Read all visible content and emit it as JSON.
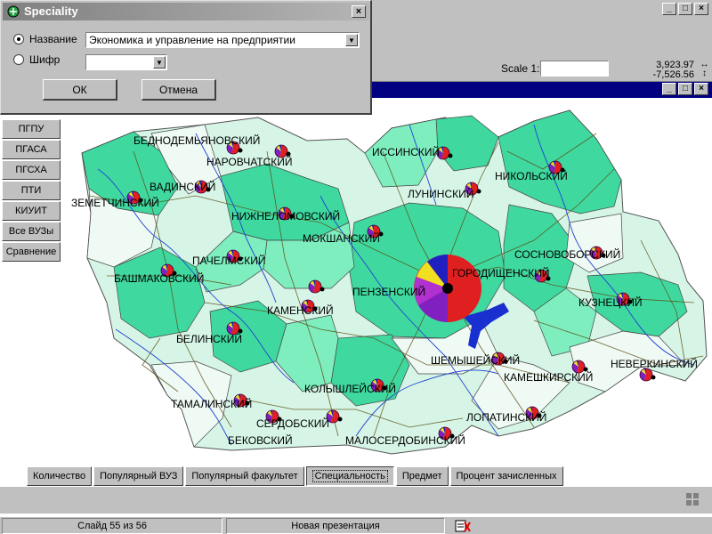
{
  "app": {
    "minimize_label": "_",
    "maximize_label": "□",
    "close_label": "×"
  },
  "view": {
    "scale_label": "Scale 1:",
    "scale_value": "",
    "coord_x": "3,923.97",
    "coord_y": "-7,526.56",
    "coord_arrows": "↔ ↕"
  },
  "dialog": {
    "title": "Speciality",
    "close_label": "×",
    "name_radio_label": "Название",
    "name_selected": "Экономика и управление на предприятии",
    "code_radio_label": "Шифр",
    "code_selected": "",
    "ok_label": "ОК",
    "cancel_label": "Отмена"
  },
  "side_buttons": [
    {
      "label": "ПГПУ"
    },
    {
      "label": "ПГАСА"
    },
    {
      "label": "ПГСХА"
    },
    {
      "label": "ПТИ"
    },
    {
      "label": "КИУИТ"
    },
    {
      "label": "Все ВУЗы"
    },
    {
      "label": "Сравнение"
    }
  ],
  "tabs": [
    {
      "label": "Количество"
    },
    {
      "label": "Популярный ВУЗ"
    },
    {
      "label": "Популярный факультет"
    },
    {
      "label": "Специальность",
      "active": true
    },
    {
      "label": "Предмет"
    },
    {
      "label": "Процент зачисленных"
    }
  ],
  "status": {
    "slide": "Слайд 55 из 56",
    "presentation": "Новая презентация"
  },
  "colors": {
    "region_dark": "#3fd9a0",
    "region_mid": "#7eeebe",
    "region_light": "#d6f5e6",
    "rivers": "#2040d0",
    "roads": "#5a4a10",
    "pie_red": "#e02020",
    "pie_purple": "#8020c0",
    "pie_blue": "#2020c0",
    "pie_yellow": "#f0e020"
  },
  "map": {
    "districts": [
      {
        "name": "БЕДНОДЕМЬЯНОВСКИЙ"
      },
      {
        "name": "НАРОВЧАТСКИЙ"
      },
      {
        "name": "ИССИНСКИЙ"
      },
      {
        "name": "НИКОЛЬСКИЙ"
      },
      {
        "name": "ВАДИНСКИЙ"
      },
      {
        "name": "ЛУНИНСКИЙ"
      },
      {
        "name": "ЗЕМЕТЧИНСКИЙ"
      },
      {
        "name": "НИЖНЕЛОМОВСКИЙ"
      },
      {
        "name": "МОКШАНСКИЙ"
      },
      {
        "name": "СОСНОВОБОРСКИЙ"
      },
      {
        "name": "ПАЧЕЛМСКИЙ"
      },
      {
        "name": "ГОРОДИЩЕНСКИЙ"
      },
      {
        "name": "БАШМАКОВСКИЙ"
      },
      {
        "name": "ПЕНЗЕНСКИЙ"
      },
      {
        "name": "КУЗНЕЦКИЙ"
      },
      {
        "name": "КАМЕНСКИЙ"
      },
      {
        "name": "БЕЛИНСКИЙ"
      },
      {
        "name": "ШЕМЫШЕЙСКИЙ"
      },
      {
        "name": "НЕВЕРКИНСКИЙ"
      },
      {
        "name": "КАМЕШКИРСКИЙ"
      },
      {
        "name": "КОЛЫШЛЕЙСКИЙ"
      },
      {
        "name": "ТАМАЛИНСКИЙ"
      },
      {
        "name": "ЛОПАТИНСКИЙ"
      },
      {
        "name": "СЕРДОБСКИЙ"
      },
      {
        "name": "БЕКОВСКИЙ"
      },
      {
        "name": "МАЛОСЕРДОБИНСКИЙ"
      }
    ]
  }
}
